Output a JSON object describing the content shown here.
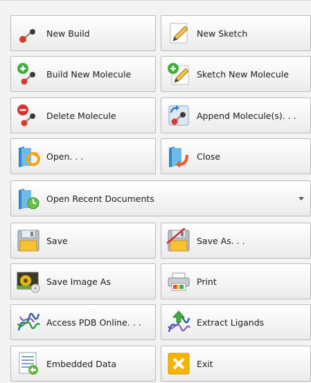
{
  "buttons": {
    "new_build": "New Build",
    "new_sketch": "New Sketch",
    "build_new_molecule": "Build New Molecule",
    "sketch_new_molecule": "Sketch New Molecule",
    "delete_molecule": "Delete Molecule",
    "append_molecules": "Append Molecule(s). . .",
    "open": "Open. . .",
    "close": "Close",
    "open_recent": "Open Recent Documents",
    "save": "Save",
    "save_as": "Save As. . .",
    "save_image_as": "Save Image As",
    "print": "Print",
    "access_pdb": "Access PDB Online. . .",
    "extract_ligands": "Extract Ligands",
    "embedded_data": "Embedded Data",
    "exit": "Exit"
  },
  "icons": {
    "new_build": "molecule-icon",
    "new_sketch": "pencil-icon",
    "build_new_molecule": "add-molecule-icon",
    "sketch_new_molecule": "add-sketch-icon",
    "delete_molecule": "delete-molecule-icon",
    "append_molecules": "append-molecule-icon",
    "open": "open-folder-icon",
    "close": "close-folder-icon",
    "open_recent": "recent-documents-icon",
    "save": "save-icon",
    "save_as": "save-as-icon",
    "save_image_as": "save-image-icon",
    "print": "printer-icon",
    "access_pdb": "protein-icon",
    "extract_ligands": "extract-ligand-icon",
    "embedded_data": "embedded-data-icon",
    "exit": "exit-icon"
  },
  "colors": {
    "button_border": "#b9b9b9",
    "panel_background": "#f3f3f3",
    "exit_icon": "#f5b400",
    "delete_badge": "#d9302c",
    "add_badge": "#3fae3a",
    "folder": "#4aa3df"
  }
}
